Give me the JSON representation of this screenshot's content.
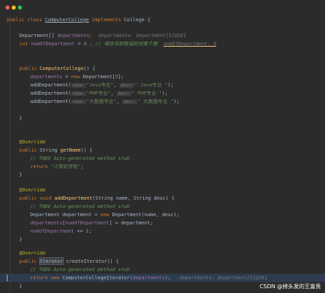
{
  "window": {
    "traffic_lights": [
      "close",
      "minimize",
      "zoom"
    ]
  },
  "code": {
    "l1": {
      "kw1": "public",
      "kw2": "class",
      "cls": "ComputerCollege",
      "kw3": "implements",
      "iface": "College {"
    },
    "l2": {
      "type": "Department[] ",
      "fld": "departments",
      "semi": ";",
      "dbg": "departments: Department[5]@581"
    },
    "l3": {
      "kw": "int ",
      "fld": "numOfDepartment",
      "eq": " = ",
      "num": "0",
      "rest": " ;",
      "cmt": "// 保存当前数组的对象个数",
      "dbg": "numOfDepartment: 5"
    },
    "l4": {
      "kw": "public ",
      "fn": "ComputerCollege",
      "rest": "() {"
    },
    "l5": {
      "fld": "departments",
      "eq": " = ",
      "kw": "new ",
      "rest": "Department[",
      "num": "5",
      "end": "];"
    },
    "l6": {
      "call": "addDepartment(",
      "h1": "name:",
      "s1": "\"Java专业\"",
      "c": ", ",
      "h2": "desc:",
      "s2": "\" Java专业 \"",
      "end": ");"
    },
    "l7": {
      "call": "addDepartment(",
      "h1": "name:",
      "s1": "\"PHP专业\"",
      "c": ", ",
      "h2": "desc:",
      "s2": "\" PHP专业 \"",
      "end": ");"
    },
    "l8": {
      "call": "addDepartment(",
      "h1": "name:",
      "s1": "\"大数据专业\"",
      "c": ", ",
      "h2": "desc:",
      "s2": "\" 大数据专业 \"",
      "end": ");"
    },
    "l9": {
      "text": "}"
    },
    "l10": {
      "ann": "@Override"
    },
    "l11": {
      "kw": "public ",
      "type": "String ",
      "fn": "getName",
      "rest": "() {"
    },
    "l12": {
      "cmt": "// TODO Auto-generated method stub"
    },
    "l13": {
      "kw": "return ",
      "str": "\"计算机学院\"",
      "end": ";"
    },
    "l14": {
      "text": "}"
    },
    "l15": {
      "ann": "@Override"
    },
    "l16": {
      "kw": "public void ",
      "fn": "addDepartment",
      "rest": "(String name, String desc) {"
    },
    "l17": {
      "cmt": "// TODO Auto-generated method stub"
    },
    "l18": {
      "a": "Department department = ",
      "kw": "new ",
      "b": "Department(name, desc);"
    },
    "l19": {
      "fld": "departments",
      "a": "[",
      "fld2": "numOfDepartment",
      "b": "] = department;"
    },
    "l20": {
      "fld": "numOfDepartment",
      "a": " += ",
      "num": "1",
      "b": ";"
    },
    "l21": {
      "text": "}"
    },
    "l22": {
      "ann": "@Override"
    },
    "l23": {
      "kw": "public ",
      "type": "Iterator",
      "rest": " createIterator() {"
    },
    "l24": {
      "cmt": "// TODO Auto-generated method stub"
    },
    "l25": {
      "kw": "return new ",
      "a": "ComputerCollegeIterator(",
      "fld": "departments",
      "b": ");",
      "dbg": "departments: Department[5]@581"
    },
    "l26": {
      "text": "}"
    }
  },
  "watermark": "CSDN @掉头发的王富贵"
}
